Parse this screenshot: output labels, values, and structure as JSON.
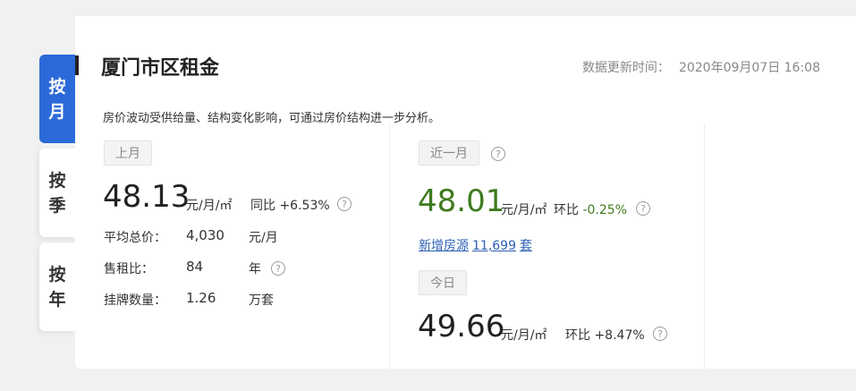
{
  "tabs": [
    {
      "chars": [
        "按",
        "月"
      ],
      "active": true
    },
    {
      "chars": [
        "按",
        "季"
      ],
      "active": false
    },
    {
      "chars": [
        "按",
        "年"
      ],
      "active": false
    }
  ],
  "header": {
    "title": "厦门市区租金",
    "update_label": "数据更新时间：",
    "update_value": "2020年09月07日 16:08"
  },
  "description": "房价波动受供给量、结构变化影响，可通过房价结构进一步分析。",
  "last_month": {
    "tag": "上月",
    "price": "48.13",
    "unit": "元/月/㎡",
    "yoy": "同比 +6.53%",
    "rows": [
      {
        "label": "平均总价：",
        "value": "4,030",
        "unit": "元/月"
      },
      {
        "label": "售租比：",
        "value": "84",
        "unit": "年"
      },
      {
        "label": "挂牌数量：",
        "value": "1.26",
        "unit": "万套"
      }
    ]
  },
  "recent_month": {
    "tag": "近一月",
    "price": "48.01",
    "unit": "元/月/㎡",
    "mom_label": "环比",
    "mom_value": "-0.25%",
    "new_listings_label": "新增房源",
    "new_listings_value": "11,699",
    "new_listings_suffix": "套"
  },
  "today": {
    "tag": "今日",
    "price": "49.66",
    "unit": "元/月/㎡",
    "mom": "环比 +8.47%"
  },
  "help_glyph": "?",
  "colors": {
    "accent": "#2c6ad9",
    "price_green": "#3e7a1f",
    "link": "#2c5fb5"
  }
}
